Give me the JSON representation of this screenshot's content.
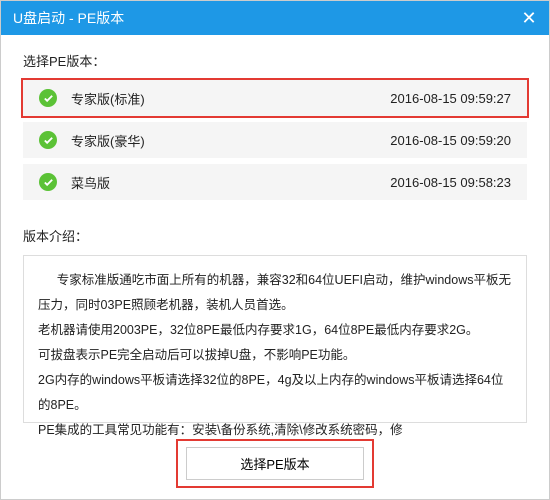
{
  "titlebar": {
    "title": "U盘启动 - PE版本"
  },
  "sections": {
    "list_label": "选择PE版本：",
    "intro_label": "版本介绍："
  },
  "versions": [
    {
      "label": "专家版(标准)",
      "time": "2016-08-15 09:59:27",
      "selected": true
    },
    {
      "label": "专家版(豪华)",
      "time": "2016-08-15 09:59:20",
      "selected": false
    },
    {
      "label": "菜鸟版",
      "time": "2016-08-15 09:58:23",
      "selected": false
    }
  ],
  "intro": {
    "p1": "专家标准版通吃市面上所有的机器，兼容32和64位UEFI启动，维护windows平板无压力，同时03PE照顾老机器，装机人员首选。",
    "p2": "老机器请使用2003PE，32位8PE最低内存要求1G，64位8PE最低内存要求2G。",
    "p3": "可拔盘表示PE完全启动后可以拔掉U盘，不影响PE功能。",
    "p4": "2G内存的windows平板请选择32位的8PE，4g及以上内存的windows平板请选择64位的8PE。",
    "p5": "PE集成的工具常见功能有：安装\\备份系统,清除\\修改系统密码，修"
  },
  "footer": {
    "select_button": "选择PE版本"
  }
}
